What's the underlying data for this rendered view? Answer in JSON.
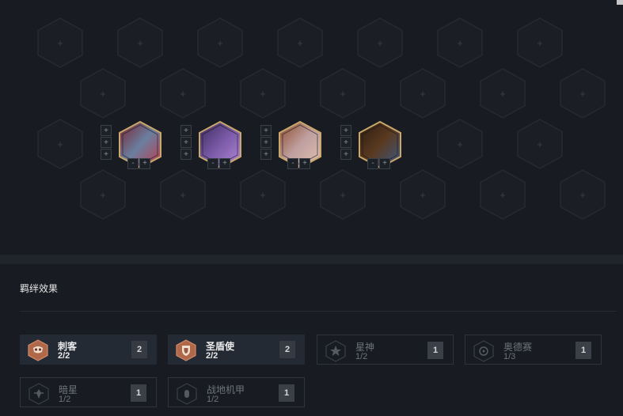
{
  "board": {
    "empty_plus": "+",
    "star_plus": "+",
    "item_minus": "-",
    "item_plus": "+",
    "champions": [
      {
        "name": "champion-1",
        "colors": [
          "#7a2230",
          "#6a7fa0",
          "#c03a4a"
        ]
      },
      {
        "name": "champion-2",
        "colors": [
          "#3a2a5a",
          "#7a5aa8",
          "#b58ad8"
        ]
      },
      {
        "name": "champion-3",
        "colors": [
          "#8a4a2a",
          "#c0a0a0",
          "#e0c0b0"
        ]
      },
      {
        "name": "champion-4",
        "colors": [
          "#2a1a10",
          "#5a3a20",
          "#3a5a8a"
        ]
      }
    ]
  },
  "synergy": {
    "title": "羁绊效果",
    "traits": [
      {
        "name": "刺客",
        "count": "2/2",
        "level": "2",
        "active": true,
        "icon": "mask-icon"
      },
      {
        "name": "圣盾使",
        "count": "2/2",
        "level": "2",
        "active": true,
        "icon": "shield-icon"
      },
      {
        "name": "星神",
        "count": "1/2",
        "level": "1",
        "active": false,
        "icon": "star-icon"
      },
      {
        "name": "奥德赛",
        "count": "1/3",
        "level": "1",
        "active": false,
        "icon": "compass-icon"
      },
      {
        "name": "暗星",
        "count": "1/2",
        "level": "1",
        "active": false,
        "icon": "dark-star-icon"
      },
      {
        "name": "战地机甲",
        "count": "1/2",
        "level": "1",
        "active": false,
        "icon": "mech-icon"
      }
    ]
  },
  "colors": {
    "background": "#181b21",
    "active_badge": "#b0684a",
    "champion_border": "#c9a86a"
  }
}
